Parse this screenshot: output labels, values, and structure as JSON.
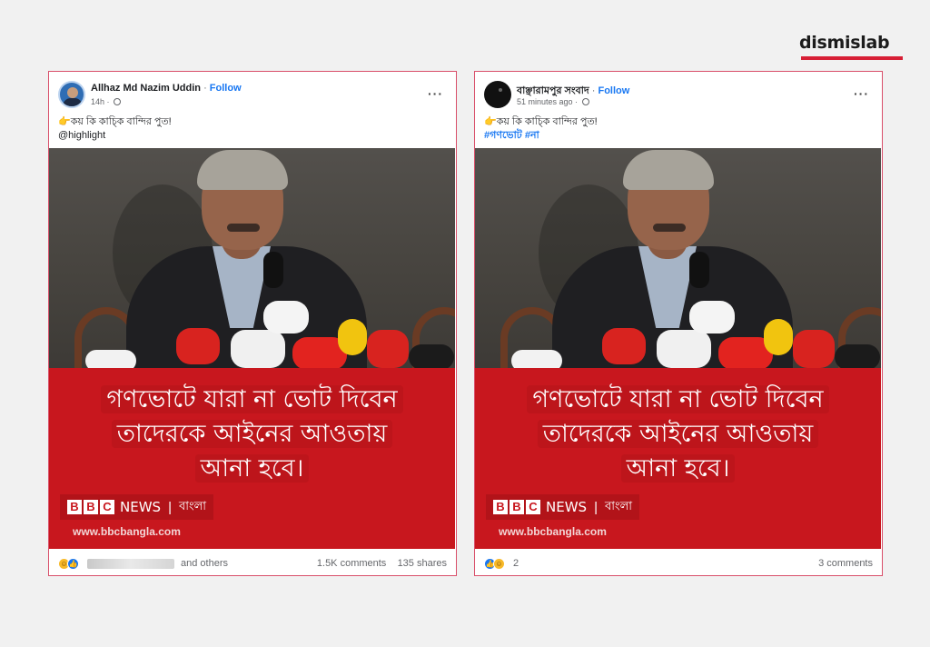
{
  "brand": {
    "logo": "dismislab",
    "accent": "#d71f35"
  },
  "posts": [
    {
      "author": "Allhaz Md Nazim Uddin",
      "follow": "Follow",
      "time": "14h ·",
      "caption_emoji": "👉",
      "caption": "কয় কি কাচ্কি বান্দির পুত!",
      "tag_line": "@highlight",
      "headline": [
        "গণভোটে যারা না ভোট দিবেন",
        "তাদেরকে আইনের আওতায়",
        "আনা হবে।"
      ],
      "bbc_blocks": [
        "B",
        "B",
        "C"
      ],
      "bbc_news": "NEWS",
      "bbc_pipe": "|",
      "bbc_lang": "বাংলা",
      "url": "www.bbcbangla.com",
      "others": "and others",
      "comments": "1.5K comments",
      "shares": "135 shares",
      "more": "···"
    },
    {
      "author": "বাঞ্ছারামপুর সংবাদ",
      "follow": "Follow",
      "time": "51 minutes ago ·",
      "caption_emoji": "👉",
      "caption": "কয় কি কাচ্কি বান্দির পুত!",
      "tag_line": "#গণভোট #না",
      "headline": [
        "গণভোটে যারা না ভোট দিবেন",
        "তাদেরকে আইনের আওতায়",
        "আনা হবে।"
      ],
      "bbc_blocks": [
        "B",
        "B",
        "C"
      ],
      "bbc_news": "NEWS",
      "bbc_pipe": "|",
      "bbc_lang": "বাংলা",
      "url": "www.bbcbangla.com",
      "reaction_count": "2",
      "comments": "3 comments",
      "more": "···"
    }
  ]
}
